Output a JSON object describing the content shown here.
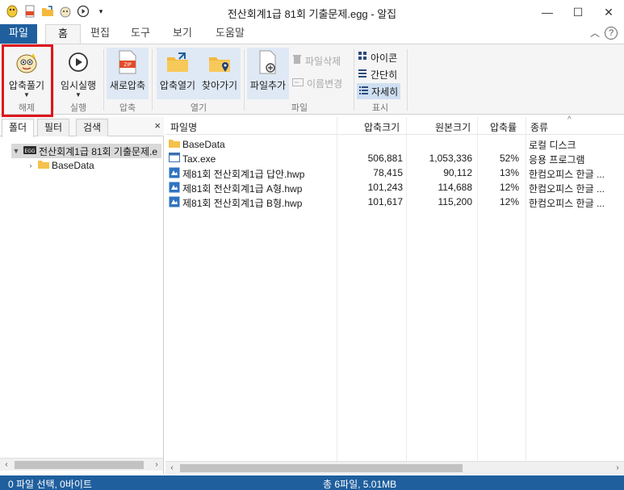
{
  "window": {
    "title": "전산회계1급 81회 기출문제.egg - 알집"
  },
  "qat": {
    "icons": [
      "app-logo-icon",
      "new-zip-icon",
      "open-folder-icon",
      "extract-icon",
      "play-icon",
      "dropdown-icon"
    ]
  },
  "tabs": {
    "file": "파일",
    "home": "홈",
    "edit": "편집",
    "tools": "도구",
    "view": "보기",
    "help": "도움말"
  },
  "ribbon": {
    "extract": {
      "label": "압축풀기",
      "group": "해제"
    },
    "run": {
      "label": "임시실행",
      "group": "실행"
    },
    "new_zip": {
      "label": "새로압축",
      "group": "압축"
    },
    "open_zip": {
      "label": "압축열기"
    },
    "find": {
      "label": "찾아가기"
    },
    "open_group": "열기",
    "add_file": {
      "label": "파일추가"
    },
    "delete_file": "파일삭제",
    "rename": "이름변경",
    "file_group": "파일",
    "view_icon": "아이콘",
    "view_simple": "간단히",
    "view_detail": "자세히",
    "display_group": "표시",
    "help_symbol": "?"
  },
  "left_panel": {
    "tabs": [
      "폴더",
      "필터",
      "검색"
    ],
    "close": "×",
    "tree": {
      "root_label": "전산회계1급 81회 기출문제.e",
      "root_badge": "EGG",
      "child_label": "BaseData"
    }
  },
  "file_list": {
    "columns": {
      "name": "파일명",
      "compressed": "압축크기",
      "original": "원본크기",
      "ratio": "압축률",
      "type": "종류"
    },
    "rows": [
      {
        "name": "BaseData",
        "compressed": "",
        "original": "",
        "ratio": "",
        "type": "로컬 디스크",
        "icon": "folder-icon"
      },
      {
        "name": "Tax.exe",
        "compressed": "506,881",
        "original": "1,053,336",
        "ratio": "52%",
        "type": "응용 프로그램",
        "icon": "exe-icon"
      },
      {
        "name": "제81회 전산회계1급 답안.hwp",
        "compressed": "78,415",
        "original": "90,112",
        "ratio": "13%",
        "type": "한컴오피스 한글 ...",
        "icon": "hwp-icon"
      },
      {
        "name": "제81회 전산회계1급 A형.hwp",
        "compressed": "101,243",
        "original": "114,688",
        "ratio": "12%",
        "type": "한컴오피스 한글 ...",
        "icon": "hwp-icon"
      },
      {
        "name": "제81회 전산회계1급 B형.hwp",
        "compressed": "101,617",
        "original": "115,200",
        "ratio": "12%",
        "type": "한컴오피스 한글 ...",
        "icon": "hwp-icon"
      }
    ]
  },
  "status": {
    "selection": "0 파일 선택, 0바이트",
    "total": "총 6파일, 5.01MB"
  }
}
